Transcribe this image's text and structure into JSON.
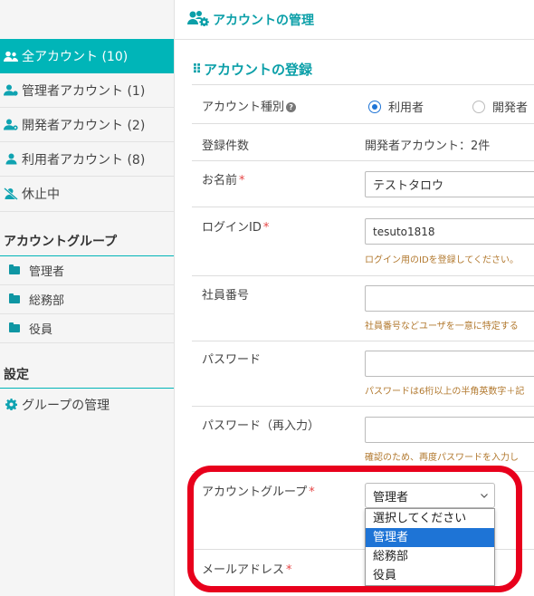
{
  "sidebar": {
    "accounts": [
      {
        "label": "全アカウント (10)",
        "icon": "users-icon",
        "active": true
      },
      {
        "label": "管理者アカウント (1)",
        "icon": "admin-user-icon"
      },
      {
        "label": "開発者アカウント (2)",
        "icon": "developer-user-icon"
      },
      {
        "label": "利用者アカウント (8)",
        "icon": "user-icon"
      },
      {
        "label": "休止中",
        "icon": "user-slash-icon"
      }
    ],
    "group_section": "アカウントグループ",
    "groups": [
      {
        "label": "管理者",
        "icon": "folder-icon"
      },
      {
        "label": "総務部",
        "icon": "folder-icon"
      },
      {
        "label": "役員",
        "icon": "folder-icon"
      }
    ],
    "settings_section": "設定",
    "settings_items": [
      {
        "label": "グループの管理",
        "icon": "gear-icon"
      }
    ]
  },
  "header": {
    "title": "アカウントの管理",
    "icon": "users-gear-icon"
  },
  "form": {
    "section_title": "アカウントの登録",
    "account_type": {
      "label": "アカウント種別",
      "options": [
        "利用者",
        "開発者"
      ],
      "selected": "利用者"
    },
    "count": {
      "label": "登録件数",
      "value": "開発者アカウント：2件"
    },
    "name": {
      "label": "お名前",
      "value": "テストタロウ"
    },
    "login_id": {
      "label": "ログインID",
      "value": "tesuto1818",
      "hint": "ログイン用のIDを登録してください。"
    },
    "employee_no": {
      "label": "社員番号",
      "value": "",
      "hint": "社員番号などユーザを一意に特定する"
    },
    "password": {
      "label": "パスワード",
      "value": "",
      "hint": "パスワードは6桁以上の半角英数字＋記"
    },
    "password_confirm": {
      "label": "パスワード（再入力）",
      "value": "",
      "hint": "確認のため、再度パスワードを入力し"
    },
    "account_group": {
      "label": "アカウントグループ",
      "value": "管理者",
      "options": [
        "選択してください",
        "管理者",
        "総務部",
        "役員"
      ],
      "selected_index": 1
    },
    "email": {
      "label": "メールアドレス"
    },
    "required_mark": "*"
  },
  "colors": {
    "accent": "#00b5b8",
    "title": "#0b9fa8",
    "hint": "#b2792f",
    "required": "#e64545",
    "highlight": "#e8001c",
    "selected_option": "#1e74d6"
  }
}
